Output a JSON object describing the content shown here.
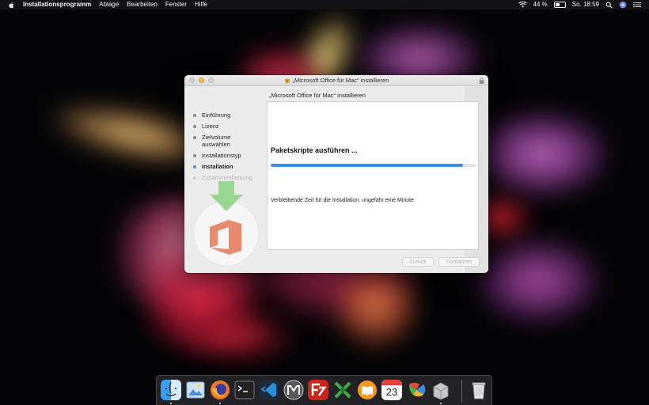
{
  "menubar": {
    "app_name": "Installationsprogramm",
    "menus": [
      "Ablage",
      "Bearbeiten",
      "Fenster",
      "Hilfe"
    ],
    "battery_percent": "44 %",
    "battery_level": 0.44,
    "clock": "So. 18:59"
  },
  "window": {
    "title": "„Microsoft Office für Mac“ installieren",
    "heading": "„Microsoft Office für Mac“ installieren",
    "steps": [
      {
        "label": "Einführung",
        "state": "done"
      },
      {
        "label": "Lizenz",
        "state": "done"
      },
      {
        "label": "Zielvolume auswählen",
        "state": "done"
      },
      {
        "label": "Installationstyp",
        "state": "done"
      },
      {
        "label": "Installation",
        "state": "active"
      },
      {
        "label": "Zusammenfassung",
        "state": "future"
      }
    ],
    "status": "Paketskripte ausführen ...",
    "progress": 0.94,
    "remaining_time": "Verbleibende Zeit für die Installation: ungefähr eine Minute",
    "back_button": "Zurück",
    "next_button": "Fortfahren"
  },
  "dock": {
    "apps": [
      "finder",
      "preview",
      "firefox",
      "terminal",
      "visual-studio-code",
      "macdown",
      "filezilla",
      "xcode-tools",
      "ibooks",
      "calendar",
      "photo-app",
      "installer",
      "trash"
    ],
    "calendar_day": "23",
    "running": [
      "finder",
      "firefox",
      "installer"
    ]
  },
  "colors": {
    "accent_blue": "#3d8fe0",
    "office_orange": "#e8633a",
    "download_green": "#8ed486"
  }
}
